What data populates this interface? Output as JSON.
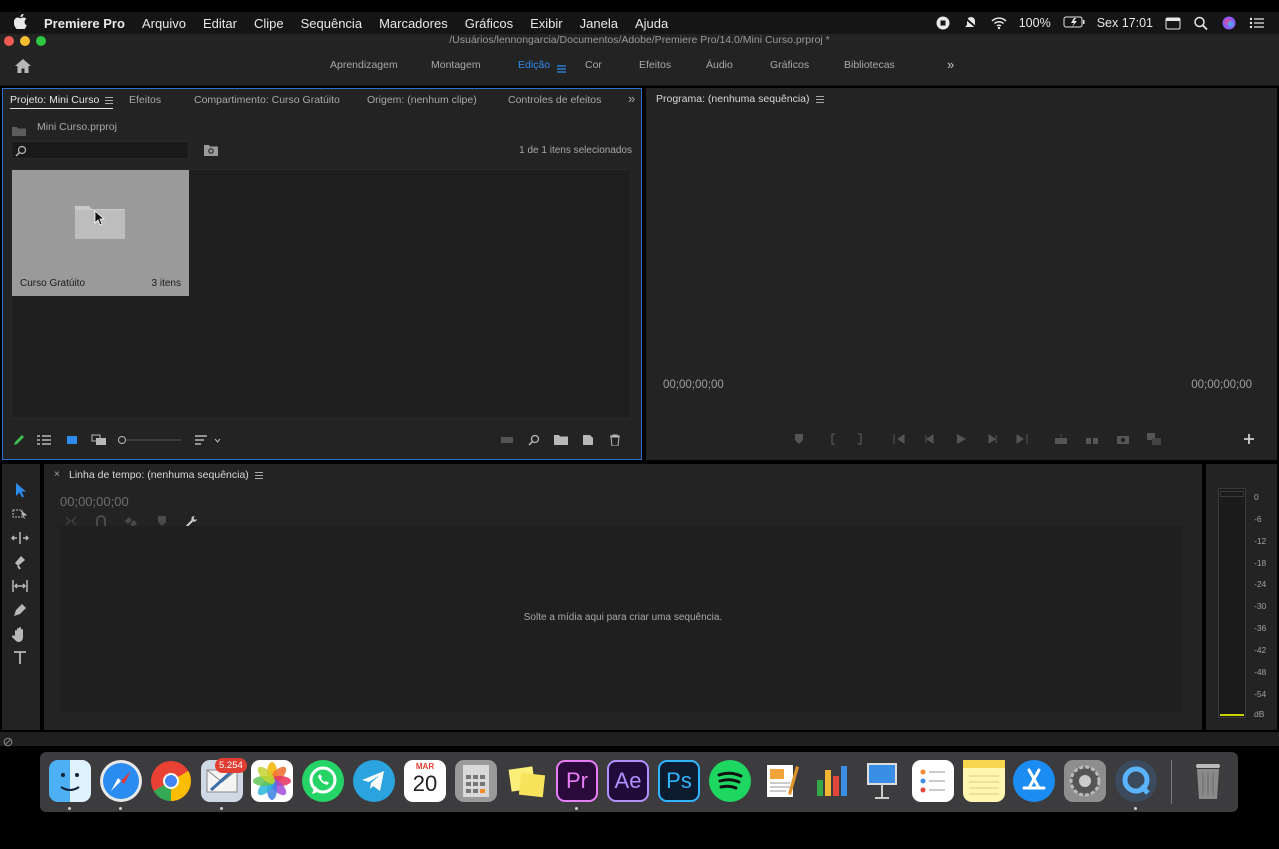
{
  "menubar": {
    "app_name": "Premiere Pro",
    "items": [
      "Arquivo",
      "Editar",
      "Clipe",
      "Sequência",
      "Marcadores",
      "Gráficos",
      "Exibir",
      "Janela",
      "Ajuda"
    ],
    "battery": "100%",
    "clock": "Sex 17:01"
  },
  "titlebar": {
    "path": "/Usuários/lennongarcia/Documentos/Adobe/Premiere Pro/14.0/Mini Curso.prproj *"
  },
  "workspaces": {
    "tabs": [
      "Aprendizagem",
      "Montagem",
      "Edição",
      "Cor",
      "Efeitos",
      "Áudio",
      "Gráficos",
      "Bibliotecas"
    ],
    "active": "Edição"
  },
  "project_panel": {
    "tabs": [
      "Projeto: Mini Curso",
      "Efeitos",
      "Compartimento: Curso Gratúito",
      "Origem: (nenhum clipe)",
      "Controles de efeitos"
    ],
    "file": "Mini Curso.prproj",
    "search_value": "",
    "selection": "1 de 1 itens selecionados",
    "bin": {
      "name": "Curso Gratúito",
      "count": "3 itens"
    }
  },
  "program_panel": {
    "title": "Programa: (nenhuma sequência)",
    "timecode_in": "00;00;00;00",
    "timecode_out": "00;00;00;00"
  },
  "timeline_panel": {
    "title": "Linha de tempo: (nenhuma sequência)",
    "timecode": "00;00;00;00",
    "empty_message": "Solte a mídia aqui para criar uma sequência."
  },
  "audio_meter": {
    "labels": [
      "0",
      "-6",
      "-12",
      "-18",
      "-24",
      "-30",
      "-36",
      "-42",
      "-48",
      "-54",
      "dB"
    ]
  },
  "dock": {
    "apps": [
      "Finder",
      "Safari",
      "Google Chrome",
      "Mail",
      "Fotos",
      "WhatsApp",
      "Telegram",
      "Calendário",
      "Calculadora",
      "Stickies",
      "Premiere Pro",
      "After Effects",
      "Photoshop",
      "Spotify",
      "Pages",
      "Numbers",
      "Keynote",
      "Lembretes",
      "Notas",
      "App Store",
      "Preferências do Sistema",
      "QuickTime Player",
      "Lixeira"
    ],
    "mail_badge": "5.254",
    "calendar_month": "MAR",
    "calendar_day": "20",
    "premiere_label": "Pr",
    "aftereffects_label": "Ae",
    "photoshop_label": "Ps"
  },
  "colors": {
    "accent": "#2d8ceb",
    "panel_bg": "#232323",
    "active_panel_border": "#2f6fd0"
  }
}
